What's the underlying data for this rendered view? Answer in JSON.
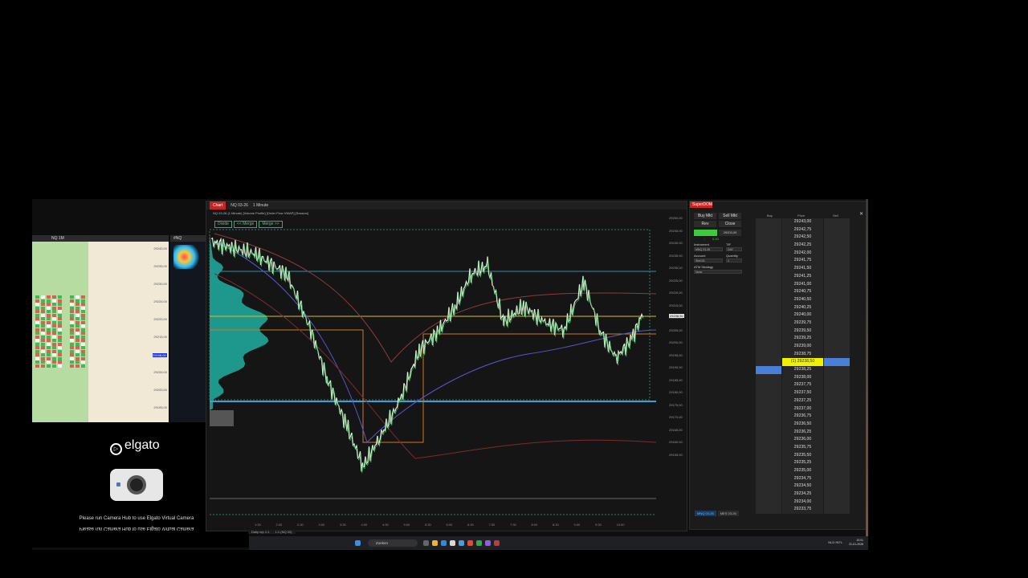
{
  "footprint": {
    "title": "NQ 1M",
    "ticks": [
      "29240,00",
      "29235,00",
      "29230,00",
      "29225,00",
      "29220,00",
      "29215,00",
      "29210,00",
      "29205,00",
      "29200,00",
      "29195,00"
    ],
    "last_price": "29198,00"
  },
  "heatmap": {
    "title": "#NQ"
  },
  "elgato": {
    "logo_text": "elgato",
    "message": "Please run Camera Hub to use Elgato Virtual Camera",
    "message_mirrored": "Please run Camera Hub to use Elgato Virtual Camera"
  },
  "chart": {
    "tabs": [
      "Chart",
      "NQ 03-26",
      "1 Minute"
    ],
    "info_line": "NQ 03-26 (1 Minute) [Volume Profile] [Order Flow VWAP] [Session]",
    "buttons": [
      "Divide",
      "<< Merge",
      "Merge >>"
    ],
    "price_labels": [
      "29250,00",
      "29245,00",
      "29240,00",
      "29235,00",
      "29230,00",
      "29225,00",
      "29220,00",
      "29215,00",
      "29210,00",
      "29205,00",
      "29200,00",
      "29195,00",
      "29190,00",
      "29185,00",
      "29180,00",
      "29175,00",
      "29170,00",
      "29165,00",
      "29160,00",
      "29155,00"
    ],
    "current_price": "29238,50",
    "time_labels": [
      "1:30",
      "2:00",
      "2:30",
      "3:00",
      "3:30",
      "4:00",
      "4:30",
      "5:00",
      "5:30",
      "6:00",
      "6:30",
      "7:00",
      "7:30",
      "8:00",
      "8:30",
      "9:00",
      "9:30",
      "10:00"
    ],
    "bottom_tab": "Daily rep 1:1",
    "bottom_tab2": "1:1 (NQ 03)"
  },
  "superdom": {
    "title": "SuperDOM",
    "buy_mkt": "Buy Mkt",
    "sell_mkt": "Sell Mkt",
    "rev": "Rev",
    "close": "Close",
    "position_value": "1",
    "position_price": "29203,00",
    "pnl": "0,00",
    "instrument_label": "Instrument",
    "instrument_value": "MNQ 03-26",
    "tif_label": "TIF",
    "tif_value": "DAY",
    "account_label": "Account",
    "account_value": "Sim101",
    "quantity_label": "Quantity",
    "quantity_value": "1",
    "atm_label": "ATM Strategy",
    "atm_value": "None",
    "col_buy": "Buy",
    "col_price": "Price",
    "col_sell": "Sell",
    "prices": [
      "29243,00",
      "29242,75",
      "29242,50",
      "29242,25",
      "29242,00",
      "29241,75",
      "29241,50",
      "29241,25",
      "29241,00",
      "29240,75",
      "29240,50",
      "29240,25",
      "29240,00",
      "29239,75",
      "29239,50",
      "29239,25",
      "29239,00",
      "29238,75",
      "29238,50",
      "29238,25",
      "29238,00",
      "29237,75",
      "29237,50",
      "29237,25",
      "29237,00",
      "29236,75",
      "29236,50",
      "29236,25",
      "29236,00",
      "29235,75",
      "29235,50",
      "29235,25",
      "29235,00",
      "29234,75",
      "29234,50",
      "29234,25",
      "29234,00",
      "29233,75"
    ],
    "current_label": "(1) 29238,50",
    "bottom_tabs": [
      "MNQ 03-26",
      "MES 03-26"
    ]
  },
  "taskbar": {
    "search_placeholder": "Zoeken",
    "tray": "NLD INTL",
    "time": "10:01",
    "date": "21-01-2026"
  }
}
